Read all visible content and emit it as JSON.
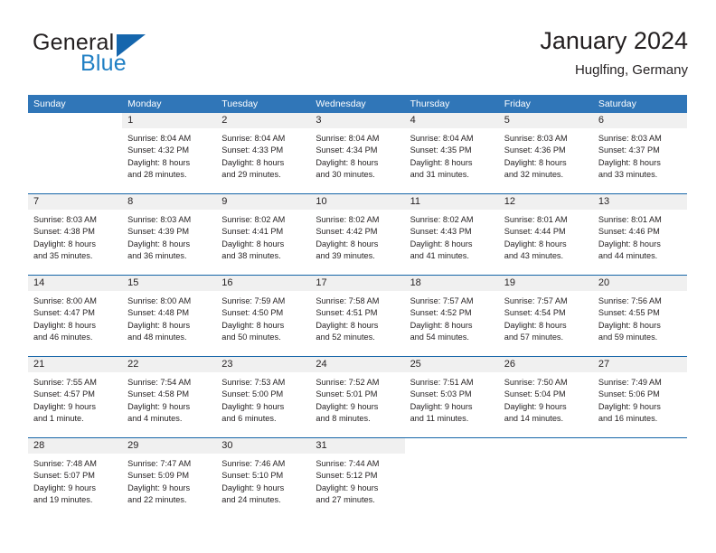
{
  "brand": {
    "name_part1": "General",
    "name_part2": "Blue",
    "logo_icon": "triangle-logo-icon"
  },
  "header": {
    "title": "January 2024",
    "location": "Huglfing, Germany"
  },
  "theme": {
    "header_blue": "#3076b8",
    "separator_blue": "#1565a8",
    "daynum_band": "#f0f0f0",
    "brand_blue": "#1f7fc4",
    "text": "#231f20"
  },
  "weekday_headers": [
    "Sunday",
    "Monday",
    "Tuesday",
    "Wednesday",
    "Thursday",
    "Friday",
    "Saturday"
  ],
  "weeks": [
    [
      {
        "day": "",
        "blank": true,
        "sunrise": "",
        "sunset": "",
        "daylight1": "",
        "daylight2": ""
      },
      {
        "day": "1",
        "sunrise": "Sunrise: 8:04 AM",
        "sunset": "Sunset: 4:32 PM",
        "daylight1": "Daylight: 8 hours",
        "daylight2": "and 28 minutes."
      },
      {
        "day": "2",
        "sunrise": "Sunrise: 8:04 AM",
        "sunset": "Sunset: 4:33 PM",
        "daylight1": "Daylight: 8 hours",
        "daylight2": "and 29 minutes."
      },
      {
        "day": "3",
        "sunrise": "Sunrise: 8:04 AM",
        "sunset": "Sunset: 4:34 PM",
        "daylight1": "Daylight: 8 hours",
        "daylight2": "and 30 minutes."
      },
      {
        "day": "4",
        "sunrise": "Sunrise: 8:04 AM",
        "sunset": "Sunset: 4:35 PM",
        "daylight1": "Daylight: 8 hours",
        "daylight2": "and 31 minutes."
      },
      {
        "day": "5",
        "sunrise": "Sunrise: 8:03 AM",
        "sunset": "Sunset: 4:36 PM",
        "daylight1": "Daylight: 8 hours",
        "daylight2": "and 32 minutes."
      },
      {
        "day": "6",
        "sunrise": "Sunrise: 8:03 AM",
        "sunset": "Sunset: 4:37 PM",
        "daylight1": "Daylight: 8 hours",
        "daylight2": "and 33 minutes."
      }
    ],
    [
      {
        "day": "7",
        "sunrise": "Sunrise: 8:03 AM",
        "sunset": "Sunset: 4:38 PM",
        "daylight1": "Daylight: 8 hours",
        "daylight2": "and 35 minutes."
      },
      {
        "day": "8",
        "sunrise": "Sunrise: 8:03 AM",
        "sunset": "Sunset: 4:39 PM",
        "daylight1": "Daylight: 8 hours",
        "daylight2": "and 36 minutes."
      },
      {
        "day": "9",
        "sunrise": "Sunrise: 8:02 AM",
        "sunset": "Sunset: 4:41 PM",
        "daylight1": "Daylight: 8 hours",
        "daylight2": "and 38 minutes."
      },
      {
        "day": "10",
        "sunrise": "Sunrise: 8:02 AM",
        "sunset": "Sunset: 4:42 PM",
        "daylight1": "Daylight: 8 hours",
        "daylight2": "and 39 minutes."
      },
      {
        "day": "11",
        "sunrise": "Sunrise: 8:02 AM",
        "sunset": "Sunset: 4:43 PM",
        "daylight1": "Daylight: 8 hours",
        "daylight2": "and 41 minutes."
      },
      {
        "day": "12",
        "sunrise": "Sunrise: 8:01 AM",
        "sunset": "Sunset: 4:44 PM",
        "daylight1": "Daylight: 8 hours",
        "daylight2": "and 43 minutes."
      },
      {
        "day": "13",
        "sunrise": "Sunrise: 8:01 AM",
        "sunset": "Sunset: 4:46 PM",
        "daylight1": "Daylight: 8 hours",
        "daylight2": "and 44 minutes."
      }
    ],
    [
      {
        "day": "14",
        "sunrise": "Sunrise: 8:00 AM",
        "sunset": "Sunset: 4:47 PM",
        "daylight1": "Daylight: 8 hours",
        "daylight2": "and 46 minutes."
      },
      {
        "day": "15",
        "sunrise": "Sunrise: 8:00 AM",
        "sunset": "Sunset: 4:48 PM",
        "daylight1": "Daylight: 8 hours",
        "daylight2": "and 48 minutes."
      },
      {
        "day": "16",
        "sunrise": "Sunrise: 7:59 AM",
        "sunset": "Sunset: 4:50 PM",
        "daylight1": "Daylight: 8 hours",
        "daylight2": "and 50 minutes."
      },
      {
        "day": "17",
        "sunrise": "Sunrise: 7:58 AM",
        "sunset": "Sunset: 4:51 PM",
        "daylight1": "Daylight: 8 hours",
        "daylight2": "and 52 minutes."
      },
      {
        "day": "18",
        "sunrise": "Sunrise: 7:57 AM",
        "sunset": "Sunset: 4:52 PM",
        "daylight1": "Daylight: 8 hours",
        "daylight2": "and 54 minutes."
      },
      {
        "day": "19",
        "sunrise": "Sunrise: 7:57 AM",
        "sunset": "Sunset: 4:54 PM",
        "daylight1": "Daylight: 8 hours",
        "daylight2": "and 57 minutes."
      },
      {
        "day": "20",
        "sunrise": "Sunrise: 7:56 AM",
        "sunset": "Sunset: 4:55 PM",
        "daylight1": "Daylight: 8 hours",
        "daylight2": "and 59 minutes."
      }
    ],
    [
      {
        "day": "21",
        "sunrise": "Sunrise: 7:55 AM",
        "sunset": "Sunset: 4:57 PM",
        "daylight1": "Daylight: 9 hours",
        "daylight2": "and 1 minute."
      },
      {
        "day": "22",
        "sunrise": "Sunrise: 7:54 AM",
        "sunset": "Sunset: 4:58 PM",
        "daylight1": "Daylight: 9 hours",
        "daylight2": "and 4 minutes."
      },
      {
        "day": "23",
        "sunrise": "Sunrise: 7:53 AM",
        "sunset": "Sunset: 5:00 PM",
        "daylight1": "Daylight: 9 hours",
        "daylight2": "and 6 minutes."
      },
      {
        "day": "24",
        "sunrise": "Sunrise: 7:52 AM",
        "sunset": "Sunset: 5:01 PM",
        "daylight1": "Daylight: 9 hours",
        "daylight2": "and 8 minutes."
      },
      {
        "day": "25",
        "sunrise": "Sunrise: 7:51 AM",
        "sunset": "Sunset: 5:03 PM",
        "daylight1": "Daylight: 9 hours",
        "daylight2": "and 11 minutes."
      },
      {
        "day": "26",
        "sunrise": "Sunrise: 7:50 AM",
        "sunset": "Sunset: 5:04 PM",
        "daylight1": "Daylight: 9 hours",
        "daylight2": "and 14 minutes."
      },
      {
        "day": "27",
        "sunrise": "Sunrise: 7:49 AM",
        "sunset": "Sunset: 5:06 PM",
        "daylight1": "Daylight: 9 hours",
        "daylight2": "and 16 minutes."
      }
    ],
    [
      {
        "day": "28",
        "sunrise": "Sunrise: 7:48 AM",
        "sunset": "Sunset: 5:07 PM",
        "daylight1": "Daylight: 9 hours",
        "daylight2": "and 19 minutes."
      },
      {
        "day": "29",
        "sunrise": "Sunrise: 7:47 AM",
        "sunset": "Sunset: 5:09 PM",
        "daylight1": "Daylight: 9 hours",
        "daylight2": "and 22 minutes."
      },
      {
        "day": "30",
        "sunrise": "Sunrise: 7:46 AM",
        "sunset": "Sunset: 5:10 PM",
        "daylight1": "Daylight: 9 hours",
        "daylight2": "and 24 minutes."
      },
      {
        "day": "31",
        "sunrise": "Sunrise: 7:44 AM",
        "sunset": "Sunset: 5:12 PM",
        "daylight1": "Daylight: 9 hours",
        "daylight2": "and 27 minutes."
      },
      {
        "day": "",
        "blank": true,
        "sunrise": "",
        "sunset": "",
        "daylight1": "",
        "daylight2": ""
      },
      {
        "day": "",
        "blank": true,
        "sunrise": "",
        "sunset": "",
        "daylight1": "",
        "daylight2": ""
      },
      {
        "day": "",
        "blank": true,
        "sunrise": "",
        "sunset": "",
        "daylight1": "",
        "daylight2": ""
      }
    ]
  ]
}
